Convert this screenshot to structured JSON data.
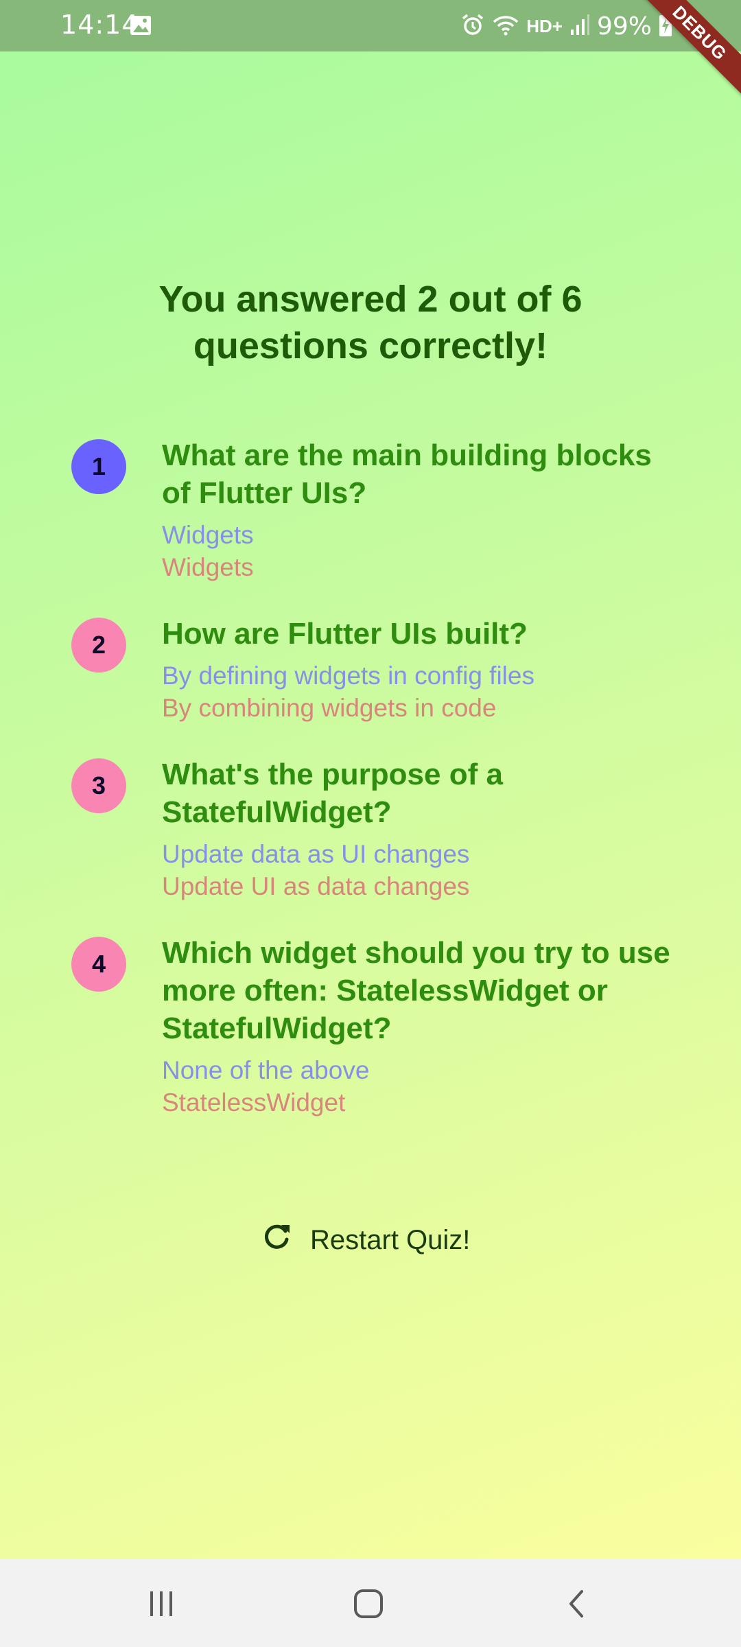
{
  "status_bar": {
    "time": "14:14",
    "network": "HD+",
    "battery": "99%",
    "icons": [
      "gallery-icon",
      "alarm-icon",
      "wifi-icon",
      "signal-icon",
      "battery-charging-icon"
    ]
  },
  "debug_banner": {
    "label": "DEBUG"
  },
  "summary": {
    "title": "You answered 2 out of 6 questions correctly!",
    "items": [
      {
        "index": "1",
        "question": "What are the main building blocks of Flutter UIs?",
        "user_answer": "Widgets",
        "correct_answer": "Widgets",
        "is_correct": true
      },
      {
        "index": "2",
        "question": "How are Flutter UIs built?",
        "user_answer": "By defining widgets in config files",
        "correct_answer": "By combining widgets in code",
        "is_correct": false
      },
      {
        "index": "3",
        "question": "What's the purpose of a StatefulWidget?",
        "user_answer": "Update data as UI changes",
        "correct_answer": "Update UI as data changes",
        "is_correct": false
      },
      {
        "index": "4",
        "question": "Which widget should you try to use more often: StatelessWidget or StatefulWidget?",
        "user_answer": "None of the above",
        "correct_answer": "StatelessWidget",
        "is_correct": false
      }
    ]
  },
  "restart_button": {
    "label": "Restart Quiz!",
    "icon": "refresh-icon"
  },
  "nav_bar": {
    "buttons": [
      "recent-apps-icon",
      "home-icon",
      "back-icon"
    ]
  },
  "colors": {
    "title": "#1e5a07",
    "question": "#2e8c0e",
    "user_answer": "#8790e6",
    "correct_answer": "#d8857c",
    "badge_correct": "#6a62ff",
    "badge_wrong": "#f985b3"
  }
}
